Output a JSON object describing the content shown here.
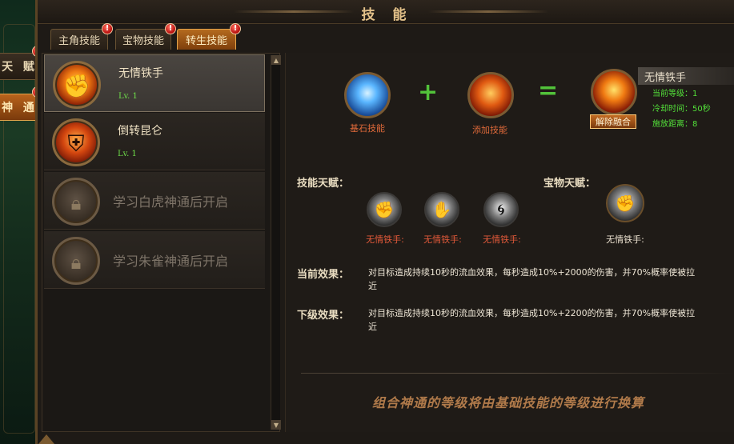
{
  "window": {
    "title": "技 能"
  },
  "side_tabs": [
    {
      "label": "天 赋"
    },
    {
      "label": "神 通"
    }
  ],
  "tabs": [
    {
      "label": "主角技能"
    },
    {
      "label": "宝物技能"
    },
    {
      "label": "转生技能"
    }
  ],
  "alert_glyph": "!",
  "skill_list": [
    {
      "name": "无情铁手",
      "level": "Lv. 1",
      "icon": "fist-fire-icon"
    },
    {
      "name": "倒转昆仑",
      "level": "Lv. 1",
      "icon": "flame-shield-icon"
    },
    {
      "locked_text": "学习白虎神通后开启",
      "icon": "lock-icon"
    },
    {
      "locked_text": "学习朱雀神通后开启",
      "icon": "lock-icon"
    }
  ],
  "combo": {
    "base_label": "基石技能",
    "add_label": "添加技能",
    "plus": "+",
    "equals": "=",
    "unfuse_button": "解除融合"
  },
  "result_card": {
    "name": "无情铁手",
    "current_level": "当前等级：1",
    "cooldown": "冷却时间：50秒",
    "range": "施放距离：8"
  },
  "talents": {
    "skill_talent_label": "技能天赋：",
    "treasure_talent_label": "宝物天赋：",
    "skill_talents": [
      "无情铁手:",
      "无情铁手:",
      "无情铁手:"
    ],
    "treasure_talents": [
      "无情铁手:"
    ]
  },
  "effects": {
    "current_label": "当前效果：",
    "current_text": "对目标造成持续10秒的流血效果，每秒造成10%+2000的伤害，并70%概率使被拉近",
    "next_label": "下级效果：",
    "next_text": "对目标造成持续10秒的流血效果，每秒造成10%+2200的伤害，并70%概率使被拉近"
  },
  "footer_note": "组合神通的等级将由基础技能的等级进行换算",
  "scroll": {
    "up": "▲",
    "down": "▼"
  },
  "colors": {
    "accent": "#b8631c",
    "level_green": "#6fe04a",
    "label_red": "#e45a3a"
  }
}
